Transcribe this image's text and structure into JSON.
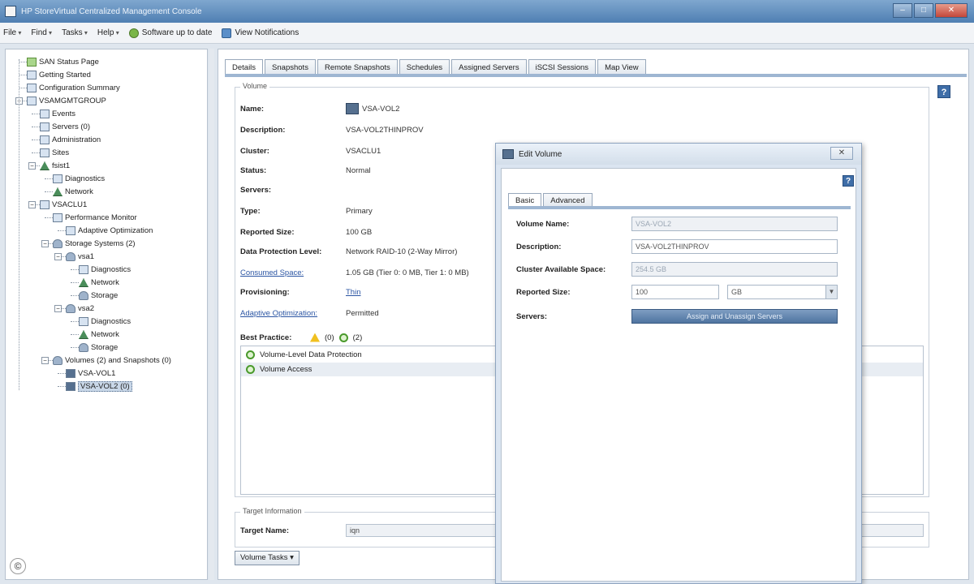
{
  "window": {
    "title": "HP StoreVirtual Centralized Management Console",
    "min": "–",
    "max": "□",
    "close": "✕"
  },
  "menu": [
    "File",
    "Find",
    "Tasks",
    "Help"
  ],
  "toolbar": {
    "software": "Software up to date",
    "notifications": "View Notifications"
  },
  "tree": [
    {
      "label": "SAN Status Page",
      "indent": 0,
      "icon": "san-status-icon",
      "kind": "green"
    },
    {
      "label": "Getting Started",
      "indent": 0,
      "icon": "getting-started-icon",
      "kind": "plain"
    },
    {
      "label": "Configuration Summary",
      "indent": 0,
      "icon": "config-summary-icon",
      "kind": "plain"
    },
    {
      "label": "VSAMGMTGROUP",
      "indent": 0,
      "icon": "management-group-icon",
      "kind": "plain",
      "expanded": true
    },
    {
      "label": "Events",
      "indent": 1,
      "icon": "events-icon",
      "kind": "plain"
    },
    {
      "label": "Servers (0)",
      "indent": 1,
      "icon": "servers-icon",
      "kind": "plain"
    },
    {
      "label": "Administration",
      "indent": 1,
      "icon": "administration-icon",
      "kind": "plain"
    },
    {
      "label": "Sites",
      "indent": 1,
      "icon": "sites-icon",
      "kind": "plain"
    },
    {
      "label": "fsist1",
      "indent": 1,
      "icon": "node-icon",
      "kind": "net",
      "expanded": true
    },
    {
      "label": "Diagnostics",
      "indent": 2,
      "icon": "diagnostics-icon",
      "kind": "plain"
    },
    {
      "label": "Network",
      "indent": 2,
      "icon": "network-icon",
      "kind": "net"
    },
    {
      "label": "VSACLU1",
      "indent": 1,
      "icon": "cluster-icon",
      "kind": "plain",
      "expanded": true
    },
    {
      "label": "Performance Monitor",
      "indent": 2,
      "icon": "performance-monitor-icon",
      "kind": "plain"
    },
    {
      "label": "Adaptive Optimization",
      "indent": 3,
      "icon": "adaptive-optimization-icon",
      "kind": "plain"
    },
    {
      "label": "Storage Systems (2)",
      "indent": 2,
      "icon": "storage-systems-icon",
      "kind": "disk",
      "expanded": true
    },
    {
      "label": "vsa1",
      "indent": 3,
      "icon": "storage-node-icon",
      "kind": "disk",
      "expanded": true
    },
    {
      "label": "Diagnostics",
      "indent": 4,
      "icon": "diagnostics-icon",
      "kind": "plain"
    },
    {
      "label": "Network",
      "indent": 4,
      "icon": "network-icon",
      "kind": "net"
    },
    {
      "label": "Storage",
      "indent": 4,
      "icon": "storage-icon",
      "kind": "disk"
    },
    {
      "label": "vsa2",
      "indent": 3,
      "icon": "storage-node-icon",
      "kind": "disk",
      "expanded": true
    },
    {
      "label": "Diagnostics",
      "indent": 4,
      "icon": "diagnostics-icon",
      "kind": "plain"
    },
    {
      "label": "Network",
      "indent": 4,
      "icon": "network-icon",
      "kind": "net"
    },
    {
      "label": "Storage",
      "indent": 4,
      "icon": "storage-icon",
      "kind": "disk"
    },
    {
      "label": "Volumes (2) and Snapshots (0)",
      "indent": 2,
      "icon": "volumes-icon",
      "kind": "disk",
      "expanded": true
    },
    {
      "label": "VSA-VOL1",
      "indent": 3,
      "icon": "volume-icon",
      "kind": "vol"
    },
    {
      "label": "VSA-VOL2 (0)",
      "indent": 3,
      "icon": "volume-icon",
      "kind": "vol",
      "selected": true
    }
  ],
  "tabs": [
    "Details",
    "Snapshots",
    "Remote Snapshots",
    "Schedules",
    "Assigned Servers",
    "iSCSI Sessions",
    "Map View"
  ],
  "volume": {
    "legend": "Volume",
    "fields": [
      {
        "label": "Name:",
        "value": "VSA-VOL2",
        "icon": true
      },
      {
        "label": "Description:",
        "value": "VSA-VOL2THINPROV"
      },
      {
        "label": "Cluster:",
        "value": "VSACLU1"
      },
      {
        "label": "Status:",
        "value": "Normal"
      },
      {
        "label": "Servers:",
        "value": ""
      },
      {
        "label": "Type:",
        "value": "Primary"
      },
      {
        "label": "Reported Size:",
        "value": "100 GB"
      },
      {
        "label": "Data Protection Level:",
        "value": "Network RAID-10 (2-Way Mirror)"
      },
      {
        "label": "Consumed Space:",
        "value": "1.05 GB (Tier 0: 0 MB, Tier 1: 0 MB)",
        "labelLink": true
      },
      {
        "label": "Provisioning:",
        "value": "Thin",
        "valueLink": true
      },
      {
        "label": "Adaptive Optimization:",
        "value": "Permitted",
        "labelLink": true
      }
    ],
    "best_practice": {
      "label": "Best Practice:",
      "warn_count": "(0)",
      "ok_count": "(2)"
    },
    "bp_items": [
      "Volume-Level Data Protection",
      "Volume Access"
    ]
  },
  "target": {
    "legend": "Target Information",
    "label": "Target Name:",
    "value": "iqn"
  },
  "volume_tasks": "Volume Tasks ▾",
  "dialog": {
    "title": "Edit Volume",
    "close": "✕",
    "help": "?",
    "tabs": [
      "Basic",
      "Advanced"
    ],
    "fields": [
      {
        "label": "Volume Name:",
        "value": "VSA-VOL2",
        "disabled": true
      },
      {
        "label": "Description:",
        "value": "VSA-VOL2THINPROV",
        "disabled": false
      },
      {
        "label": "Cluster Available Space:",
        "value": "254.5 GB",
        "disabled": true
      }
    ],
    "reported_size": {
      "label": "Reported Size:",
      "value": "100",
      "unit": "GB"
    },
    "servers": {
      "label": "Servers:",
      "button": "Assign and Unassign Servers"
    }
  },
  "help": "?",
  "copyright": "©"
}
